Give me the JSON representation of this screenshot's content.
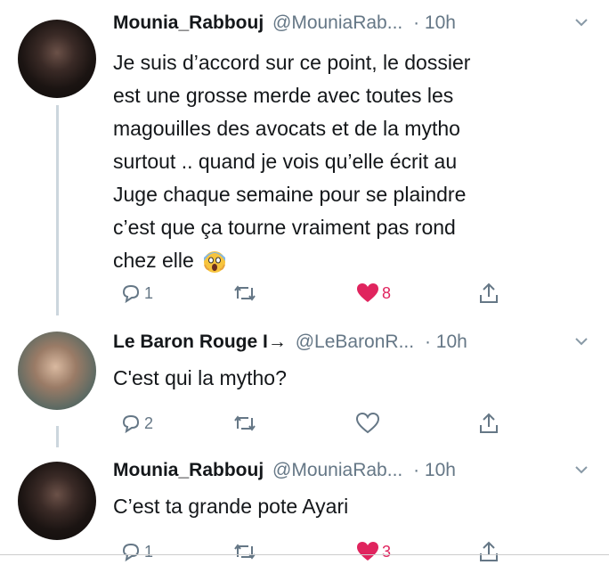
{
  "tweets": [
    {
      "name": "Mounia_Rabbouj",
      "handle": "@MouniaRab...",
      "time": "· 10h",
      "text_lines": [
        "Je suis d’accord sur ce point, le dossier",
        "est une grosse merde avec toutes les",
        "magouilles des avocats et de la mytho",
        "surtout .. quand je vois qu’elle écrit au",
        "Juge chaque semaine pour se plaindre",
        "c’est que ça tourne vraiment pas rond",
        "chez elle"
      ],
      "emoji": "screaming-face-emoji",
      "replies": "1",
      "retweets": "",
      "likes": "8",
      "liked": true
    },
    {
      "name": "Le Baron Rouge I→",
      "handle": "@LeBaronR...",
      "time": "· 10h",
      "text_lines": [
        "C'est qui la mytho?"
      ],
      "replies": "2",
      "retweets": "",
      "likes": "",
      "liked": false
    },
    {
      "name": "Mounia_Rabbouj",
      "handle": "@MouniaRab...",
      "time": "· 10h",
      "text_lines": [
        "C’est ta grande pote Ayari"
      ],
      "replies": "1",
      "retweets": "",
      "likes": "3",
      "liked": true
    }
  ],
  "colors": {
    "like": "#e0245e",
    "meta": "#657786",
    "text": "#14171a",
    "thread": "#ccd6dd"
  },
  "icons": [
    "reply-icon",
    "retweet-icon",
    "like-icon",
    "share-icon",
    "chevron-down-icon"
  ]
}
